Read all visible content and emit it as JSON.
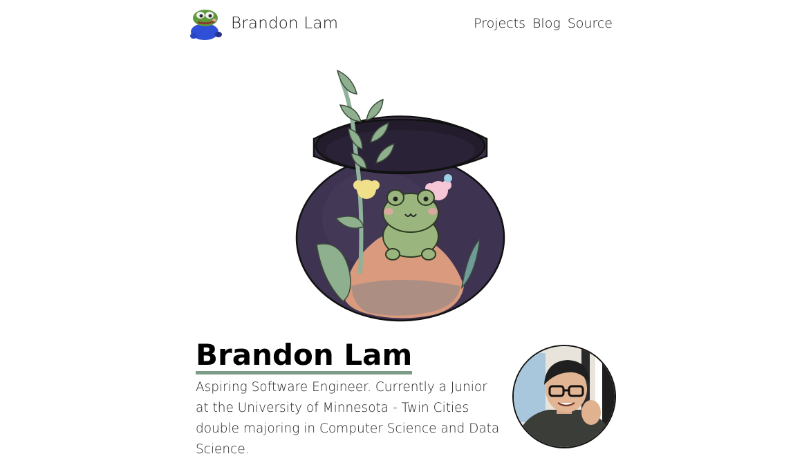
{
  "header": {
    "brand_name": "Brandon Lam",
    "nav": [
      {
        "label": "Projects"
      },
      {
        "label": "Blog"
      },
      {
        "label": "Source"
      }
    ]
  },
  "hero": {
    "image_icon": "frog-terrarium-illustration"
  },
  "intro": {
    "title": "Brandon Lam",
    "bio": "Aspiring Software Engineer. Currently a Junior at the University of Minnesota - Twin Cities double majoring in Computer Science and Data Science.",
    "avatar_icon": "profile-photo"
  },
  "colors": {
    "accent_underline": "#7c9c88",
    "jar": "#3e3350",
    "frog": "#9bb57e",
    "leaf": "#8fb08f",
    "mound": "#d99a7d"
  }
}
